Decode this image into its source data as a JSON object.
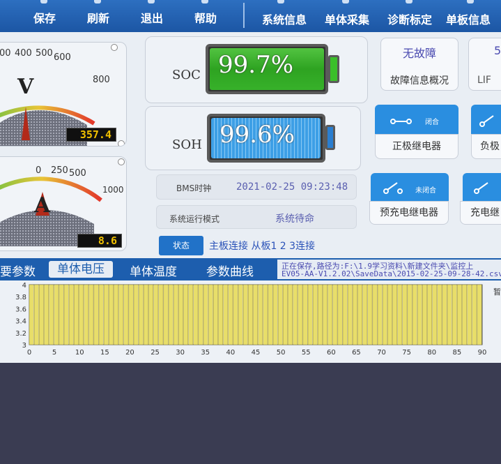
{
  "toolbar": {
    "items": [
      "保存",
      "刷新",
      "退出",
      "帮助"
    ],
    "nav": [
      "系统信息",
      "单体采集",
      "诊断标定",
      "单板信息"
    ]
  },
  "voltage_gauge": {
    "scale_labels": [
      "00",
      "400",
      "500",
      "600",
      "800"
    ],
    "unit": "V",
    "value": "357.4",
    "reading": 357.4
  },
  "current_gauge": {
    "scale_labels": [
      "0",
      "250",
      "500",
      "1000"
    ],
    "unit": "A",
    "value": "8.6",
    "reading": 8.6
  },
  "soc": {
    "label": "SOC",
    "value": "99.7%",
    "level": 0.997
  },
  "soh": {
    "label": "SOH",
    "value": "99.6%",
    "level": 0.996
  },
  "bms_clock": {
    "label": "BMS时钟",
    "value": "2021-02-25 09:23:48"
  },
  "run_mode": {
    "label": "系统运行模式",
    "value": "系统待命"
  },
  "status": {
    "label": "状态",
    "value": "主板连接 从板1 2 3连接"
  },
  "fault": {
    "status": "无故障",
    "overview": "故障信息概况",
    "side_status": "5",
    "side_label": "LIF"
  },
  "relays": [
    {
      "name": "正极继电器",
      "state": "闭合"
    },
    {
      "name": "负极",
      "state": ""
    },
    {
      "name": "预充电继电器",
      "state": "未闭合"
    },
    {
      "name": "充电继",
      "state": ""
    }
  ],
  "tabs": [
    "要参数",
    "单体电压",
    "单体温度",
    "参数曲线"
  ],
  "save": {
    "line1": "正在保存,路径为:F:\\1.9学习资料\\新建文件夹\\监控上",
    "line2": "EV05-AA-V1.2.02\\SaveData\\2015-02-25-09-28-42.csv"
  },
  "chart_data": {
    "type": "bar",
    "y_tick_labels": [
      "4",
      "3.8",
      "3.6",
      "3.4",
      "3.2",
      "3"
    ],
    "x_tick_labels": [
      "0",
      "5",
      "10",
      "15",
      "20",
      "25",
      "30",
      "35",
      "40",
      "45",
      "50",
      "55",
      "60",
      "65",
      "70",
      "75",
      "80",
      "85",
      "90"
    ],
    "ylim": [
      3,
      4
    ],
    "xlim": [
      0,
      90
    ],
    "bar_count": 91,
    "bar_value": 4.0,
    "bar_color": "#e8de6a",
    "right_label": "暂"
  }
}
